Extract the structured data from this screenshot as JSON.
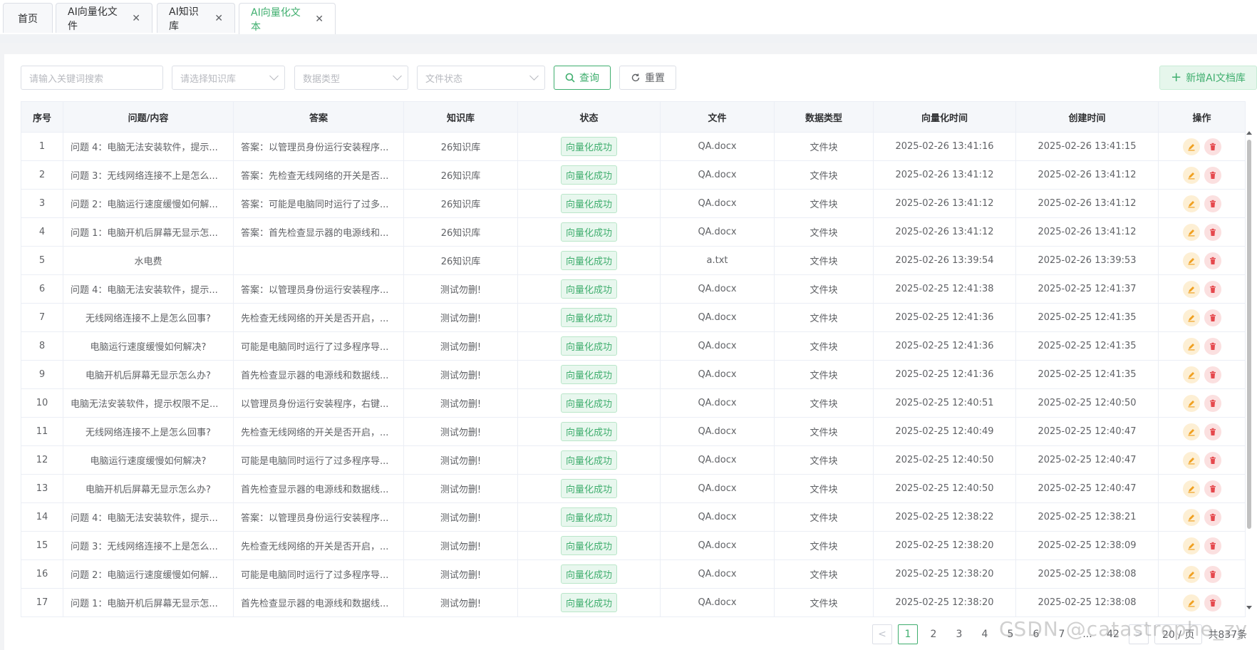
{
  "tabs": [
    {
      "label": "首页",
      "closable": false,
      "active": false
    },
    {
      "label": "AI向量化文件",
      "closable": true,
      "active": false
    },
    {
      "label": "AI知识库",
      "closable": true,
      "active": false
    },
    {
      "label": "AI向量化文本",
      "closable": true,
      "active": true
    }
  ],
  "filters": {
    "keyword_placeholder": "请输入关键词搜索",
    "kb_placeholder": "请选择知识库",
    "type_placeholder": "数据类型",
    "status_placeholder": "文件状态",
    "search_label": "查询",
    "reset_label": "重置",
    "add_label": "新增AI文档库"
  },
  "table": {
    "headers": [
      "序号",
      "问题/内容",
      "答案",
      "知识库",
      "状态",
      "文件",
      "数据类型",
      "向量化时间",
      "创建时间",
      "操作"
    ],
    "rows": [
      {
        "no": "1",
        "q": "问题 4：电脑无法安装软件，提示...",
        "a": "答案：以管理员身份运行安装程序...",
        "kb": "26知识库",
        "status": "向量化成功",
        "file": "QA.docx",
        "type": "文件块",
        "vt": "2025-02-26 13:41:16",
        "ct": "2025-02-26 13:41:15"
      },
      {
        "no": "2",
        "q": "问题 3：无线网络连接不上是怎么...",
        "a": "答案：先检查无线网络的开关是否...",
        "kb": "26知识库",
        "status": "向量化成功",
        "file": "QA.docx",
        "type": "文件块",
        "vt": "2025-02-26 13:41:12",
        "ct": "2025-02-26 13:41:12"
      },
      {
        "no": "3",
        "q": "问题 2：电脑运行速度缓慢如何解...",
        "a": "答案：可能是电脑同时运行了过多...",
        "kb": "26知识库",
        "status": "向量化成功",
        "file": "QA.docx",
        "type": "文件块",
        "vt": "2025-02-26 13:41:12",
        "ct": "2025-02-26 13:41:12"
      },
      {
        "no": "4",
        "q": "问题 1：电脑开机后屏幕无显示怎...",
        "a": "答案：首先检查显示器的电源线和...",
        "kb": "26知识库",
        "status": "向量化成功",
        "file": "QA.docx",
        "type": "文件块",
        "vt": "2025-02-26 13:41:12",
        "ct": "2025-02-26 13:41:12"
      },
      {
        "no": "5",
        "q": "水电费",
        "a": "",
        "kb": "26知识库",
        "status": "向量化成功",
        "file": "a.txt",
        "type": "文件块",
        "vt": "2025-02-26 13:39:54",
        "ct": "2025-02-26 13:39:53"
      },
      {
        "no": "6",
        "q": "问题 4：电脑无法安装软件，提示...",
        "a": "答案：以管理员身份运行安装程序...",
        "kb": "测试勿删!",
        "status": "向量化成功",
        "file": "QA.docx",
        "type": "文件块",
        "vt": "2025-02-25 12:41:38",
        "ct": "2025-02-25 12:41:37"
      },
      {
        "no": "7",
        "q": "无线网络连接不上是怎么回事?",
        "a": "先检查无线网络的开关是否开启，...",
        "kb": "测试勿删!",
        "status": "向量化成功",
        "file": "QA.docx",
        "type": "文件块",
        "vt": "2025-02-25 12:41:36",
        "ct": "2025-02-25 12:41:35"
      },
      {
        "no": "8",
        "q": "电脑运行速度缓慢如何解决?",
        "a": "可能是电脑同时运行了过多程序导...",
        "kb": "测试勿删!",
        "status": "向量化成功",
        "file": "QA.docx",
        "type": "文件块",
        "vt": "2025-02-25 12:41:36",
        "ct": "2025-02-25 12:41:35"
      },
      {
        "no": "9",
        "q": "电脑开机后屏幕无显示怎么办?",
        "a": "首先检查显示器的电源线和数据线...",
        "kb": "测试勿删!",
        "status": "向量化成功",
        "file": "QA.docx",
        "type": "文件块",
        "vt": "2025-02-25 12:41:36",
        "ct": "2025-02-25 12:41:35"
      },
      {
        "no": "10",
        "q": "电脑无法安装软件，提示权限不足...",
        "a": "以管理员身份运行安装程序，右键...",
        "kb": "测试勿删!",
        "status": "向量化成功",
        "file": "QA.docx",
        "type": "文件块",
        "vt": "2025-02-25 12:40:51",
        "ct": "2025-02-25 12:40:50"
      },
      {
        "no": "11",
        "q": "无线网络连接不上是怎么回事?",
        "a": "先检查无线网络的开关是否开启，...",
        "kb": "测试勿删!",
        "status": "向量化成功",
        "file": "QA.docx",
        "type": "文件块",
        "vt": "2025-02-25 12:40:49",
        "ct": "2025-02-25 12:40:47"
      },
      {
        "no": "12",
        "q": "电脑运行速度缓慢如何解决?",
        "a": "可能是电脑同时运行了过多程序导...",
        "kb": "测试勿删!",
        "status": "向量化成功",
        "file": "QA.docx",
        "type": "文件块",
        "vt": "2025-02-25 12:40:50",
        "ct": "2025-02-25 12:40:47"
      },
      {
        "no": "13",
        "q": "电脑开机后屏幕无显示怎么办?",
        "a": "首先检查显示器的电源线和数据线...",
        "kb": "测试勿删!",
        "status": "向量化成功",
        "file": "QA.docx",
        "type": "文件块",
        "vt": "2025-02-25 12:40:50",
        "ct": "2025-02-25 12:40:47"
      },
      {
        "no": "14",
        "q": "问题 4：电脑无法安装软件，提示...",
        "a": "答案：以管理员身份运行安装程序...",
        "kb": "测试勿删!",
        "status": "向量化成功",
        "file": "QA.docx",
        "type": "文件块",
        "vt": "2025-02-25 12:38:22",
        "ct": "2025-02-25 12:38:21"
      },
      {
        "no": "15",
        "q": "问题 3：无线网络连接不上是怎么...",
        "a": "先检查无线网络的开关是否开启，...",
        "kb": "测试勿删!",
        "status": "向量化成功",
        "file": "QA.docx",
        "type": "文件块",
        "vt": "2025-02-25 12:38:20",
        "ct": "2025-02-25 12:38:09"
      },
      {
        "no": "16",
        "q": "问题 2：电脑运行速度缓慢如何解...",
        "a": "可能是电脑同时运行了过多程序导...",
        "kb": "测试勿删!",
        "status": "向量化成功",
        "file": "QA.docx",
        "type": "文件块",
        "vt": "2025-02-25 12:38:20",
        "ct": "2025-02-25 12:38:08"
      },
      {
        "no": "17",
        "q": "问题 1：电脑开机后屏幕无显示怎...",
        "a": "首先检查显示器的电源线和数据线...",
        "kb": "测试勿删!",
        "status": "向量化成功",
        "file": "QA.docx",
        "type": "文件块",
        "vt": "2025-02-25 12:38:20",
        "ct": "2025-02-25 12:38:08"
      }
    ]
  },
  "pagination": {
    "prev": "<",
    "pages": [
      "1",
      "2",
      "3",
      "4",
      "5",
      "6",
      "7",
      "...",
      "42"
    ],
    "current": "1",
    "next": ">",
    "page_size": "20 / 页",
    "total": "共837条"
  },
  "watermark": "CSDN @catastrophe_zy",
  "colors": {
    "accent": "#3fae6e",
    "edit": "#f0a020",
    "delete": "#e5484d"
  },
  "icons": {
    "search": "search-icon",
    "reset": "refresh-icon",
    "add": "plus-icon",
    "edit": "edit-icon",
    "delete": "trash-icon",
    "close": "close-icon"
  }
}
